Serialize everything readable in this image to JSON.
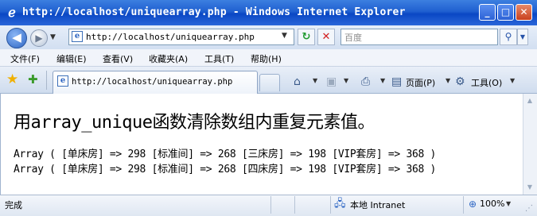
{
  "window": {
    "title": "http://localhost/uniquearray.php - Windows Internet Explorer",
    "icon": "e-icon",
    "min_label": "_",
    "max_label": "□",
    "close_label": "✕"
  },
  "address_bar": {
    "url": "http://localhost/uniquearray.php",
    "search_placeholder": "百度"
  },
  "menu": [
    "文件(F)",
    "编辑(E)",
    "查看(V)",
    "收藏夹(A)",
    "工具(T)",
    "帮助(H)"
  ],
  "tab": {
    "label": "http://localhost/uniquearray.php"
  },
  "toolbar": {
    "page_label": "页面(P)",
    "tools_label": "工具(O)"
  },
  "page": {
    "heading": "用array_unique函数清除数组内重复元素值。",
    "lines": [
      "Array ( [单床房] => 298 [标准间] => 268 [三床房] => 198 [VIP套房] => 368 )",
      "Array ( [单床房] => 298 [标准间] => 268 [四床房] => 198 [VIP套房] => 368 )"
    ]
  },
  "status": {
    "text": "完成",
    "zone": "本地 Intranet",
    "zoom": "100%"
  },
  "colors": {
    "titlebar": "#1f5fd0",
    "background": "#ffffff"
  }
}
